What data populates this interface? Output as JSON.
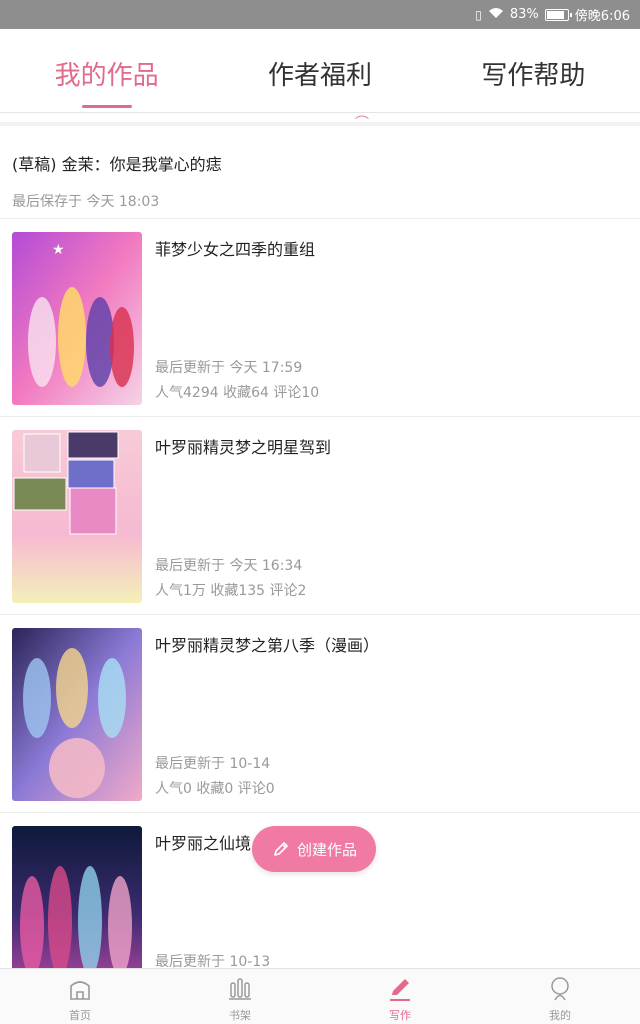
{
  "status_bar": {
    "battery": "83%",
    "time": "傍晚6:06",
    "battery_level": 0.83
  },
  "tabs": [
    {
      "label": "我的作品",
      "active": true
    },
    {
      "label": "作者福利",
      "active": false
    },
    {
      "label": "写作帮助",
      "active": false
    }
  ],
  "draft": {
    "title": "(草稿) 金茉：你是我掌心的痣",
    "saved": "最后保存于 今天 18:03"
  },
  "works": [
    {
      "title": "菲梦少女之四季的重组",
      "updated": "最后更新于 今天 17:59",
      "stats": "人气4294 收藏64 评论10"
    },
    {
      "title": "叶罗丽精灵梦之明星驾到",
      "updated": "最后更新于 今天 16:34",
      "stats": "人气1万 收藏135 评论2"
    },
    {
      "title": "叶罗丽精灵梦之第八季（漫画）",
      "updated": "最后更新于 10-14",
      "stats": "人气0 收藏0 评论0"
    },
    {
      "title": "叶罗丽之仙境",
      "updated": "最后更新于 10-13",
      "stats": ""
    }
  ],
  "fab": {
    "label": "创建作品"
  },
  "nav": [
    {
      "label": "首页",
      "active": false
    },
    {
      "label": "书架",
      "active": false
    },
    {
      "label": "写作",
      "active": true
    },
    {
      "label": "我的",
      "active": false
    }
  ],
  "colors": {
    "accent": "#e06b8b",
    "fab": "#f07aa3",
    "status_bar": "#8e8e8e"
  }
}
